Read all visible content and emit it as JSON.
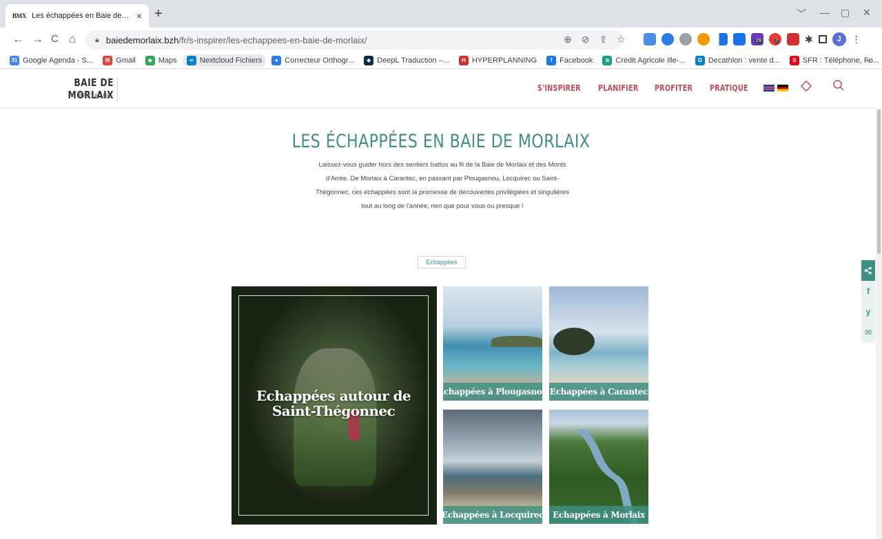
{
  "browser": {
    "tab": {
      "favicon": "BMX",
      "title": "Les échappées en Baie de Morlai",
      "close": "×"
    },
    "new_tab": "+",
    "window_controls": [
      "﹀",
      "—",
      "▢",
      "✕"
    ],
    "nav": {
      "back": "←",
      "forward": "→",
      "reload": "C",
      "home": "⌂"
    },
    "address": {
      "host": "baiedemorlaix.bzh",
      "path": "/fr/s-inspirer/les-echappees-en-baie-de-morlaix/"
    },
    "bookmarks": [
      {
        "label": "Google Agenda - S...",
        "icon": "calendar-icon",
        "color": "#4285f4",
        "glyph": "31"
      },
      {
        "label": "Gmail",
        "icon": "gmail-icon",
        "color": "#ea4335",
        "glyph": "M"
      },
      {
        "label": "Maps",
        "icon": "maps-icon",
        "color": "#34a853",
        "glyph": "◆"
      },
      {
        "label": "Nextcloud Fichiers",
        "icon": "nextcloud-icon",
        "color": "#0082c9",
        "glyph": "∞"
      },
      {
        "label": "Correcteur Orthogr...",
        "icon": "correcteur-icon",
        "color": "#2b7de9",
        "glyph": "●"
      },
      {
        "label": "DeepL Traduction –...",
        "icon": "deepl-icon",
        "color": "#0f2b46",
        "glyph": "◆"
      },
      {
        "label": "HYPERPLANNING",
        "icon": "hyperplanning-icon",
        "color": "#d32f2f",
        "glyph": "H"
      },
      {
        "label": "Facebook",
        "icon": "facebook-icon",
        "color": "#1877f2",
        "glyph": "f"
      },
      {
        "label": "Crédit Agricole Ille-...",
        "icon": "credit-agricole-icon",
        "color": "#16a085",
        "glyph": "≋"
      },
      {
        "label": "Decathlon : vente d...",
        "icon": "decathlon-icon",
        "color": "#0082c3",
        "glyph": "D"
      },
      {
        "label": "SFR : Téléphone, Fo...",
        "icon": "sfr-icon",
        "color": "#e2001a",
        "glyph": "S"
      }
    ],
    "bookmarks_more": "»",
    "badges": {
      "ext1": "29",
      "ext2": "2"
    },
    "avatar_letter": "J"
  },
  "site": {
    "logo_main": "BAIE DE MORLAIX",
    "logo_sub": "BRETAGNE",
    "nav": [
      "S'INSPIRER",
      "PLANIFIER",
      "PROFITER",
      "PRATIQUE"
    ],
    "accent": "#c54a5a",
    "brand_teal": "#3f8f84"
  },
  "main": {
    "title": "LES ÉCHAPPÉES EN BAIE DE MORLAIX",
    "intro_lines": [
      "Laissez-vous guider hors des sentiers battus au fil de la Baie de Morlaix et des Monts",
      "d'Arrée. De Morlaix à Carantec, en passant par Plougasnou, Locquirec ou Saint-",
      "Thégonnec, ces échappées sont la promesse de découvertes privilégiées et singulières",
      "tout au long de l'année, rien que pour vous ou presque !"
    ],
    "tag": "Echappées",
    "cards": {
      "big": "Echappées autour de Saint-Thégonnec",
      "c1": "Echappées à Plougasnou",
      "c2": "Echappées à Carantec",
      "c3": "Echappées à Locquirec",
      "c4": "Echappées à Morlaix"
    }
  },
  "share": {
    "main": "share-icon",
    "items": [
      "f",
      "y",
      "✉"
    ]
  }
}
